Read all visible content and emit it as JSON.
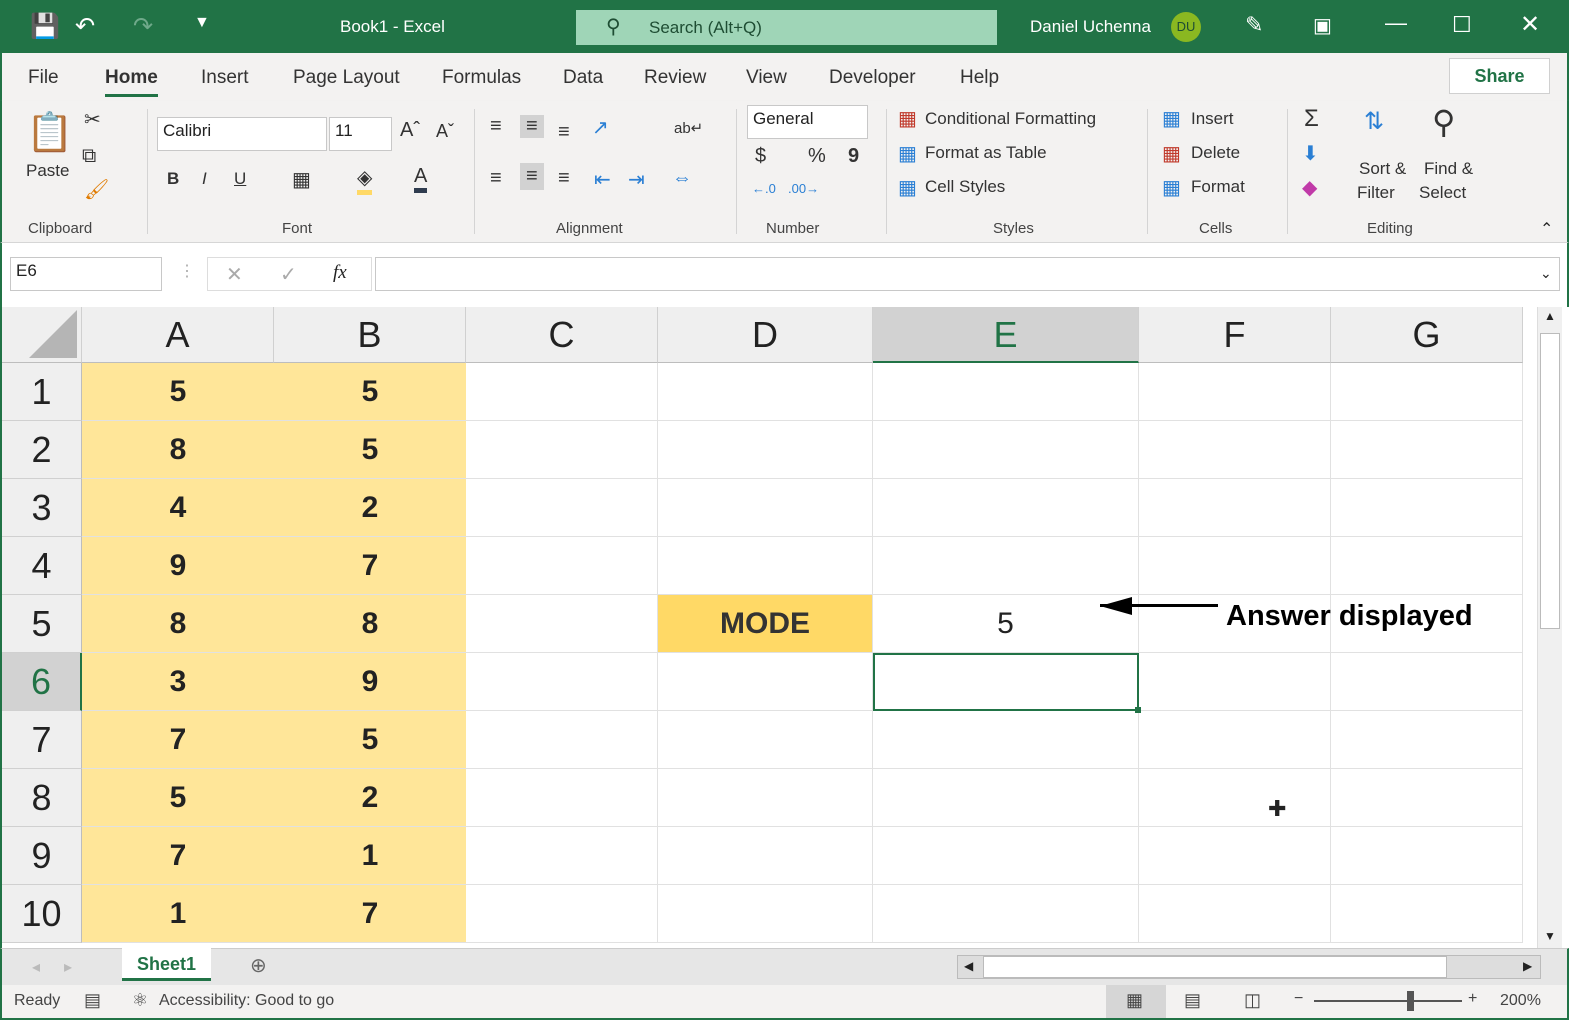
{
  "titlebar": {
    "doc_title": "Book1  -  Excel",
    "search_placeholder": "Search (Alt+Q)",
    "user_name": "Daniel Uchenna",
    "user_initials": "DU"
  },
  "tabs": [
    "File",
    "Home",
    "Insert",
    "Page Layout",
    "Formulas",
    "Data",
    "Review",
    "View",
    "Developer",
    "Help"
  ],
  "share": "Share",
  "ribbon": {
    "clipboard": {
      "paste": "Paste",
      "label": "Clipboard"
    },
    "font": {
      "name": "Calibri",
      "size": "11",
      "label": "Font",
      "bold": "B",
      "italic": "I",
      "underline": "U"
    },
    "alignment": {
      "label": "Alignment"
    },
    "number": {
      "format": "General",
      "currency": "$",
      "percent": "%",
      "comma": "9",
      "label": "Number"
    },
    "styles": {
      "conditional": "Conditional Formatting",
      "format_table": "Format as Table",
      "cell_styles": "Cell Styles",
      "label": "Styles"
    },
    "cells": {
      "insert": "Insert",
      "delete": "Delete",
      "format": "Format",
      "label": "Cells"
    },
    "editing": {
      "sort1": "Sort &",
      "sort2": "Filter",
      "find1": "Find &",
      "find2": "Select",
      "label": "Editing"
    }
  },
  "formula_bar": {
    "name_box": "E6",
    "formula": "",
    "fx": "fx"
  },
  "grid": {
    "columns": [
      "A",
      "B",
      "C",
      "D",
      "E",
      "F",
      "G"
    ],
    "rows": [
      "1",
      "2",
      "3",
      "4",
      "5",
      "6",
      "7",
      "8",
      "9",
      "10"
    ],
    "col_a": [
      "5",
      "8",
      "4",
      "9",
      "8",
      "3",
      "7",
      "5",
      "7",
      "1"
    ],
    "col_b": [
      "5",
      "5",
      "2",
      "7",
      "8",
      "9",
      "5",
      "2",
      "1",
      "7"
    ],
    "d5": "MODE",
    "e5": "5",
    "annotation": "Answer displayed",
    "selected": "E6"
  },
  "sheets": {
    "active": "Sheet1"
  },
  "status": {
    "ready": "Ready",
    "accessibility": "Accessibility: Good to go",
    "zoom": "200%"
  },
  "colors": {
    "brand": "#217346",
    "highlight": "#ffe699",
    "mode_fill": "#ffd966"
  }
}
